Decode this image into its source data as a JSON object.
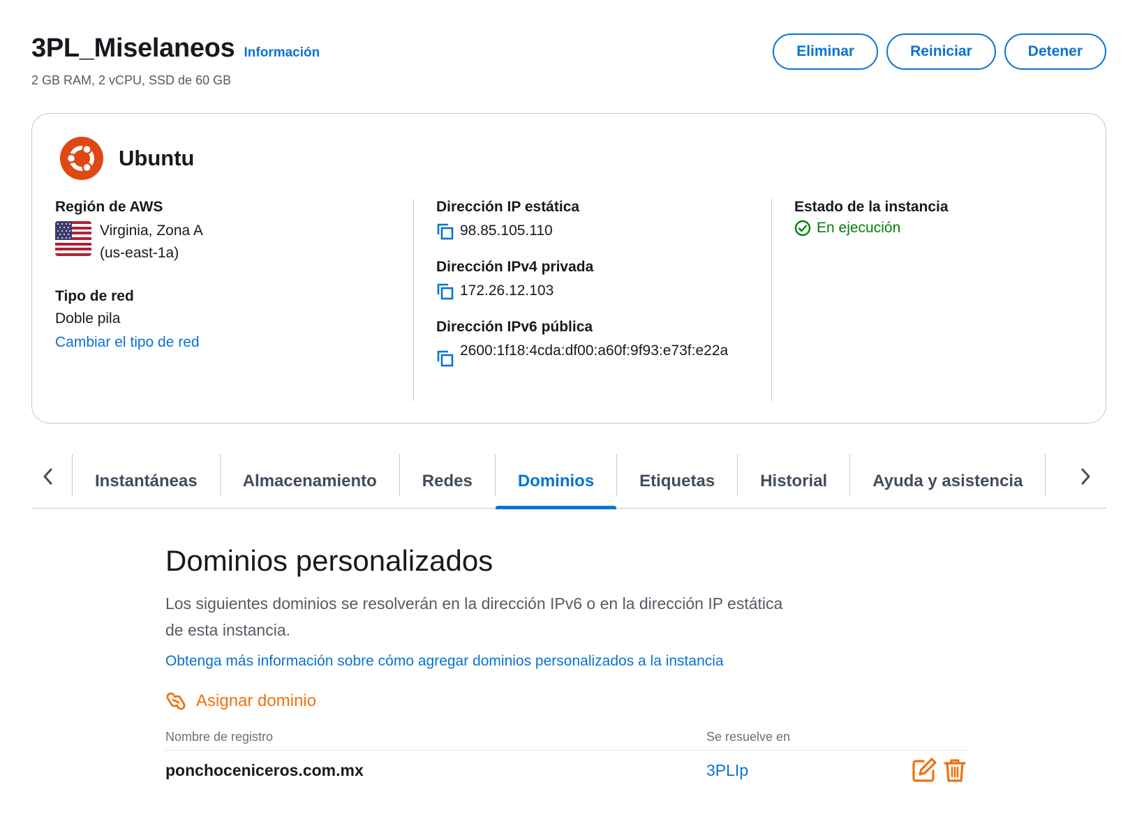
{
  "header": {
    "title": "3PL_Miselaneos",
    "info_link": "Información",
    "subtitle": "2 GB RAM, 2 vCPU, SSD de 60 GB",
    "actions": {
      "delete": "Eliminar",
      "restart": "Reiniciar",
      "stop": "Detener"
    }
  },
  "instance": {
    "os_name": "Ubuntu",
    "region_label": "Región de AWS",
    "region_line1": "Virginia, Zona A",
    "region_line2": "(us-east-1a)",
    "network_label": "Tipo de red",
    "network_value": "Doble pila",
    "network_change_link": "Cambiar el tipo de red",
    "static_ip_label": "Dirección IP estática",
    "static_ip": "98.85.105.110",
    "private_ipv4_label": "Dirección IPv4 privada",
    "private_ipv4": "172.26.12.103",
    "public_ipv6_label": "Dirección IPv6 pública",
    "public_ipv6": "2600:1f18:4cda:df00:a60f:9f93:e73f:e22a",
    "state_label": "Estado de la instancia",
    "state_value": "En ejecución"
  },
  "tabs": [
    {
      "label": "Instantáneas"
    },
    {
      "label": "Almacenamiento"
    },
    {
      "label": "Redes"
    },
    {
      "label": "Dominios"
    },
    {
      "label": "Etiquetas"
    },
    {
      "label": "Historial"
    },
    {
      "label": "Ayuda y asistencia"
    }
  ],
  "active_tab": "Dominios",
  "domains": {
    "title": "Dominios personalizados",
    "description": "Los siguientes dominios se resolverán en la dirección IPv6 o en la dirección IP estática de esta instancia.",
    "learn_more": "Obtenga más información sobre cómo agregar dominios personalizados a la instancia",
    "assign_label": "Asignar dominio",
    "columns": {
      "record_name": "Nombre de registro",
      "resolves_to": "Se resuelve en"
    },
    "rows": [
      {
        "record_name": "ponchoceniceros.com.mx",
        "resolves_to": "3PLIp"
      }
    ]
  },
  "colors": {
    "accent": "#0972d3",
    "success": "#037f0c",
    "orange": "#ec7211",
    "ubuntu": "#dd4814"
  }
}
